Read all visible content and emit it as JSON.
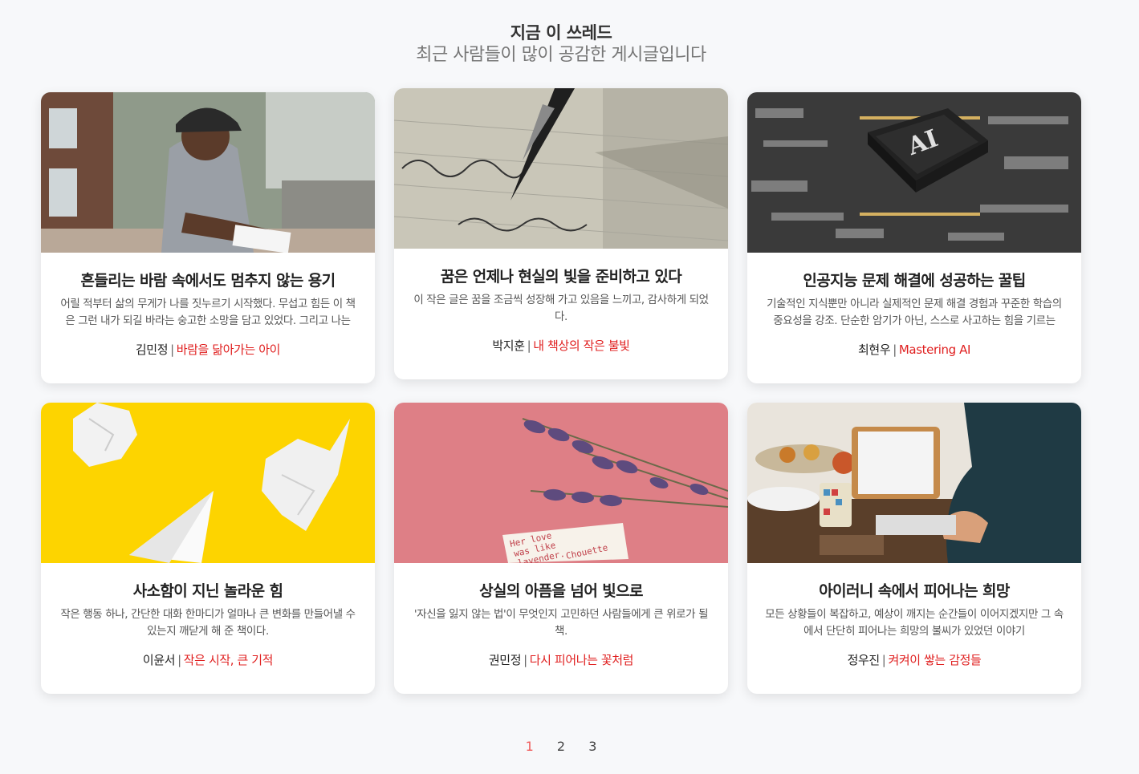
{
  "header": {
    "title": "지금 이 쓰레드",
    "subtitle": "최근 사람들이 많이 공감한 게시글입니다"
  },
  "cards": [
    {
      "title": "흔들리는 바람 속에서도 멈추지 않는 용기",
      "desc": "어릴 적부터 삶의 무게가 나를 짓누르기 시작했다. 무섭고 힘든 이 책은 그런 내가 되길 바라는 숭고한 소망을 담고 있었다. 그리고 나는",
      "author": "김민정",
      "book": "바람을 닮아가는 아이",
      "image": "man-writing-photo"
    },
    {
      "title": "꿈은 언제나 현실의 빛을 준비하고 있다",
      "desc": "이 작은 글은 꿈을 조금씩 성장해 가고 있음을 느끼고, 감사하게 되었다.",
      "author": "박지훈",
      "book": "내 책상의 작은 불빛",
      "image": "fountain-pen-photo"
    },
    {
      "title": "인공지능 문제 해결에 성공하는 꿀팁",
      "desc": "기술적인 지식뿐만 아니라 실제적인 문제 해결 경험과 꾸준한 학습의 중요성을 강조. 단순한 암기가 아닌, 스스로 사고하는 힘을 기르는",
      "author": "최현우",
      "book": "Mastering AI",
      "image": "ai-chip-photo",
      "chip_text": "AI"
    },
    {
      "title": "사소함이 지닌 놀라운 힘",
      "desc": "작은 행동 하나, 간단한 대화 한마디가 얼마나 큰 변화를 만들어낼 수 있는지 깨닫게 해 준 책이다.",
      "author": "이윤서",
      "book": "작은 시작, 큰 기적",
      "image": "paper-plane-photo"
    },
    {
      "title": "상실의 아픔을 넘어 빛으로",
      "desc": "'자신을 잃지 않는 법'이 무엇인지 고민하던 사람들에게 큰 위로가 될 책.",
      "author": "권민정",
      "book": "다시 피어나는 꽃처럼",
      "image": "lavender-photo",
      "note_lines": [
        "Her love",
        "was like",
        "lavender.",
        "Chouette"
      ]
    },
    {
      "title": "아이러니 속에서 피어나는 희망",
      "desc": "모든 상황들이 복잡하고, 예상이 깨지는 순간들이 이어지겠지만 그 속에서 단단히 피어나는 희망의 불씨가 있었던 이야기",
      "author": "정우진",
      "book": "켜켜이 쌓는 감정들",
      "image": "laptop-desk-photo"
    }
  ],
  "pagination": {
    "pages": [
      "1",
      "2",
      "3"
    ],
    "active": "1"
  },
  "colors": {
    "accent": "#e02020",
    "active_page": "#f05a5a",
    "background": "#f7f8fa"
  }
}
